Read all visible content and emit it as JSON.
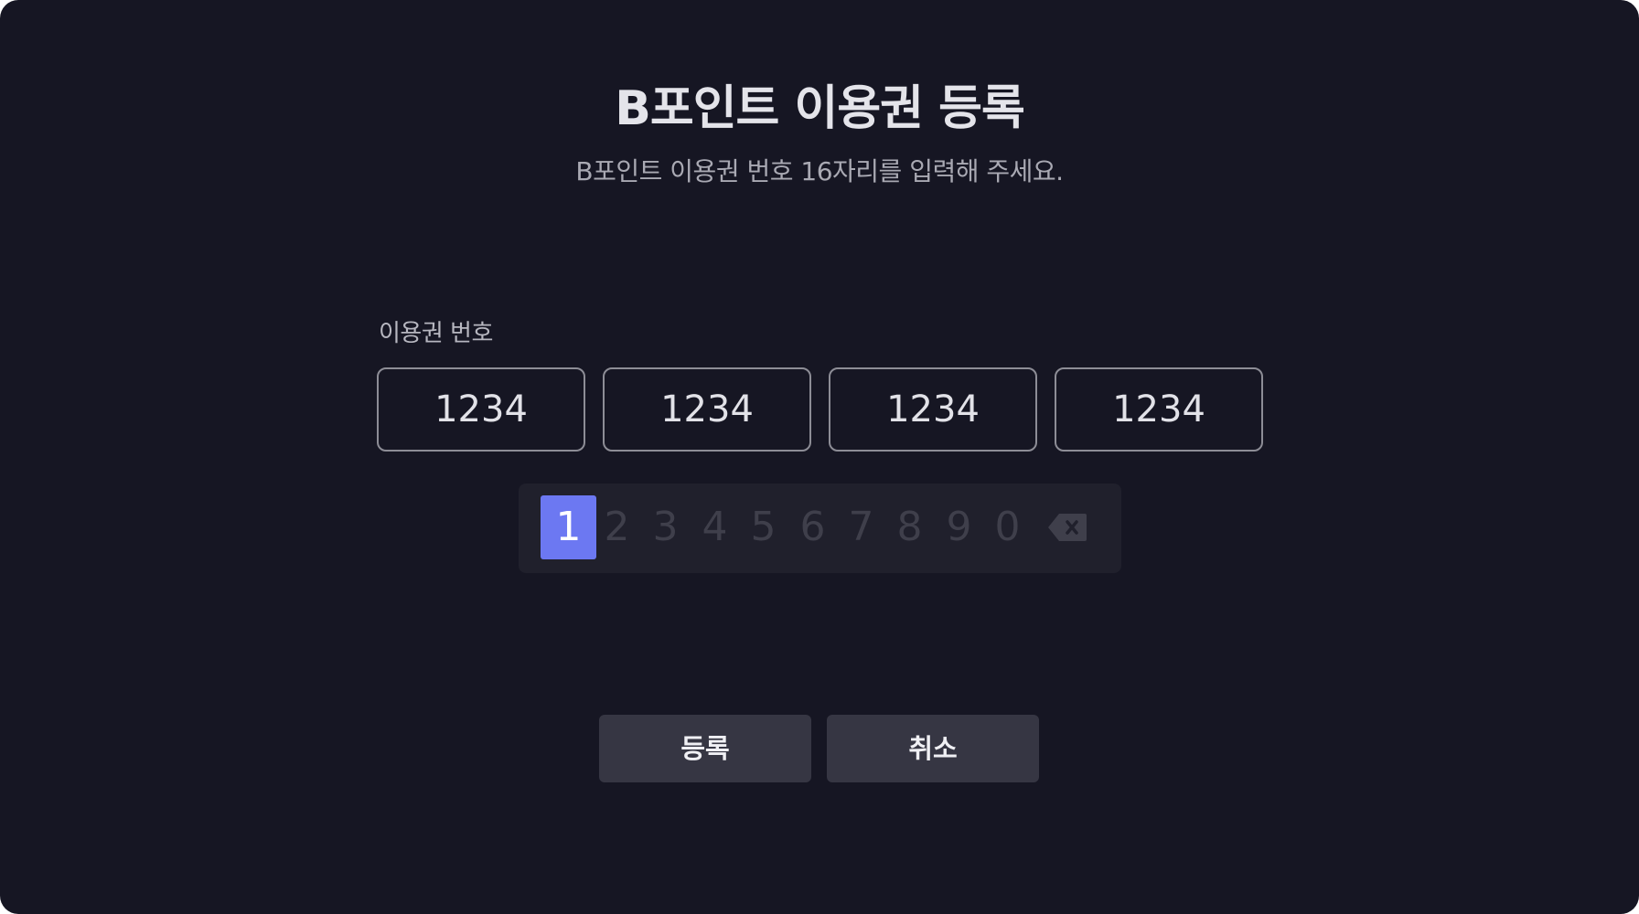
{
  "header": {
    "title": "B포인트 이용권 등록",
    "subtitle": "B포인트 이용권 번호 16자리를 입력해 주세요."
  },
  "form": {
    "field_label": "이용권 번호",
    "code_segments": [
      "1234",
      "1234",
      "1234",
      "1234"
    ]
  },
  "keypad": {
    "keys": [
      "1",
      "2",
      "3",
      "4",
      "5",
      "6",
      "7",
      "8",
      "9",
      "0"
    ],
    "selected_key": "1",
    "backspace_icon": "backspace-icon"
  },
  "actions": {
    "register_label": "등록",
    "cancel_label": "취소"
  },
  "colors": {
    "background": "#161623",
    "accent": "#6c78f2",
    "button": "#363643"
  }
}
